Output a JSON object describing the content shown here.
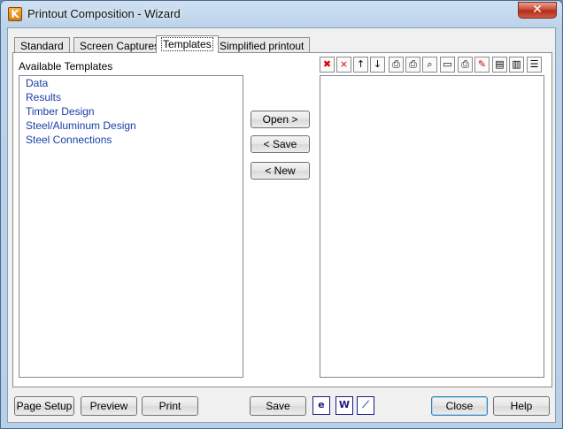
{
  "window": {
    "title": "Printout Composition - Wizard",
    "close_glyph": "✕"
  },
  "tabs": [
    {
      "label": "Standard",
      "active": false
    },
    {
      "label": "Screen Captures",
      "active": false
    },
    {
      "label": "Templates",
      "active": true
    },
    {
      "label": "Simplified printout",
      "active": false
    }
  ],
  "templates": {
    "label": "Available Templates",
    "items": [
      "Data",
      "Results",
      "Timber Design",
      "Steel/Aluminum Design",
      "Steel Connections"
    ]
  },
  "middle_buttons": {
    "open": "Open >",
    "save": "< Save",
    "new": "< New"
  },
  "toolbar_icons": [
    "delete-icon",
    "delete-all-icon",
    "move-up-icon",
    "move-down-icon",
    "print-settings-icon",
    "print-remove-icon",
    "preview-page-icon",
    "page-setup-icon",
    "print-icon",
    "edit-icon",
    "save-template-icon",
    "save-as-icon",
    "properties-icon"
  ],
  "footer": {
    "page_setup": "Page Setup",
    "preview": "Preview",
    "print": "Print",
    "save": "Save",
    "close": "Close",
    "help": "Help",
    "export_icons": [
      "html-export-icon",
      "word-export-icon",
      "chart-export-icon"
    ]
  },
  "colors": {
    "list_text": "#1a3ea8",
    "accent": "#3c7fb1"
  }
}
